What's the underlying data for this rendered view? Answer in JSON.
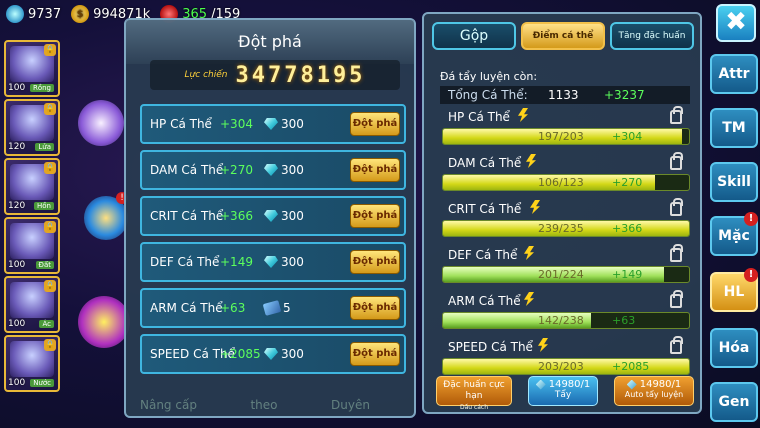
{
  "topbar": {
    "gems": "9737",
    "gold": "994871k",
    "stamina_current": "365",
    "stamina_max": "/159"
  },
  "characters": [
    {
      "level": "100",
      "tag": "Rồng"
    },
    {
      "level": "120",
      "tag": "Lửa"
    },
    {
      "level": "120",
      "tag": "Hồn"
    },
    {
      "level": "100",
      "tag": "Đất"
    },
    {
      "level": "100",
      "tag": "Ác"
    },
    {
      "level": "100",
      "tag": "Nước"
    }
  ],
  "breakthrough": {
    "title": "Đột phá",
    "power_label": "Lực chiến",
    "power_value": "34778195",
    "button_label": "Đột phá",
    "rows": [
      {
        "name": "HP Cá Thể",
        "bonus": "+304",
        "cost": "300",
        "currency": "diamond-icon"
      },
      {
        "name": "DAM Cá Thể",
        "bonus": "+270",
        "cost": "300",
        "currency": "diamond-icon"
      },
      {
        "name": "CRIT Cá Thể",
        "bonus": "+366",
        "cost": "300",
        "currency": "diamond-icon"
      },
      {
        "name": "DEF Cá Thể",
        "bonus": "+149",
        "cost": "300",
        "currency": "diamond-icon"
      },
      {
        "name": "ARM Cá Thể",
        "bonus": "+63",
        "cost": "5",
        "currency": "scroll-icon"
      },
      {
        "name": "SPEED Cá Thể",
        "bonus": "+2085",
        "cost": "300",
        "currency": "diamond-icon"
      }
    ],
    "bottom_labels": [
      "Nâng cấp",
      "theo",
      "Duyên"
    ]
  },
  "stats_panel": {
    "tabs": {
      "merge": "Gộp",
      "points": "Điểm cá thể",
      "special": "Tăng đặc huấn"
    },
    "remaining_label": "Đá tẩy luyện còn:",
    "total_label": "Tổng Cá Thể:",
    "total_value": "1133",
    "total_plus": "+3237",
    "stats": [
      {
        "name": "HP Cá Thể",
        "progress": "197/203",
        "increase": "+304",
        "ratio": 0.97
      },
      {
        "name": "DAM Cá Thể",
        "progress": "106/123",
        "increase": "+270",
        "ratio": 0.86
      },
      {
        "name": "CRIT Cá Thể",
        "progress": "239/235",
        "increase": "+366",
        "ratio": 1.0
      },
      {
        "name": "DEF Cá Thể",
        "progress": "201/224",
        "increase": "+149",
        "ratio": 0.9
      },
      {
        "name": "ARM Cá Thể",
        "progress": "142/238",
        "increase": "+63",
        "ratio": 0.6
      },
      {
        "name": "SPEED Cá Thể",
        "progress": "203/203",
        "increase": "+2085",
        "ratio": 1.0
      }
    ],
    "actions": {
      "special_label": "Đặc huấn cực hạn",
      "special_sub": "Dấu cách",
      "wash_qty": "14980/1",
      "wash_label": "Tẩy",
      "auto_qty": "14980/1",
      "auto_label": "Auto tẩy luyện"
    }
  },
  "side_menu": {
    "close": "✖",
    "items": [
      {
        "label": "Attr",
        "badge": ""
      },
      {
        "label": "TM",
        "badge": ""
      },
      {
        "label": "Skill",
        "badge": ""
      },
      {
        "label": "Mặc",
        "badge": "!"
      },
      {
        "label": "HL",
        "badge": "!"
      },
      {
        "label": "Hóa",
        "badge": ""
      },
      {
        "label": "Gen",
        "badge": ""
      }
    ]
  },
  "colors": {
    "accent": "#4fc7e6",
    "bonus": "#5cff5c",
    "gold_button": "#d49a1a"
  }
}
